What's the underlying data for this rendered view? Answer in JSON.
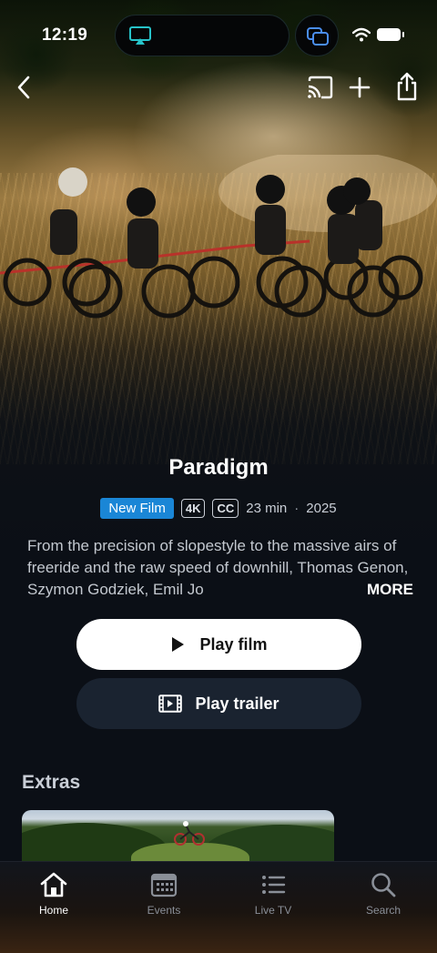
{
  "status_bar": {
    "time": "12:19"
  },
  "film": {
    "title": "Paradigm",
    "badge_new": "New Film",
    "badge_quality": "4K",
    "badge_captions": "CC",
    "duration": "23 min",
    "separator": "·",
    "year": "2025",
    "description": "From the precision of slopestyle to the massive airs of freeride and the raw speed of downhill, Thomas Genon, Szymon Godziek, Emil Jo",
    "more_label": "MORE"
  },
  "actions": {
    "play_film_label": "Play film",
    "play_trailer_label": "Play trailer"
  },
  "extras": {
    "heading": "Extras"
  },
  "tab_bar": {
    "items": [
      {
        "label": "Home",
        "icon": "home-icon",
        "active": true
      },
      {
        "label": "Events",
        "icon": "calendar-icon",
        "active": false
      },
      {
        "label": "Live TV",
        "icon": "list-icon",
        "active": false
      },
      {
        "label": "Search",
        "icon": "search-icon",
        "active": false
      }
    ]
  },
  "colors": {
    "accent_badge": "#1a86d6",
    "background": "#0b0f16",
    "secondary_button": "#1a2330",
    "airplay_teal": "#27c3c9",
    "share_blue": "#4a8ef0"
  }
}
